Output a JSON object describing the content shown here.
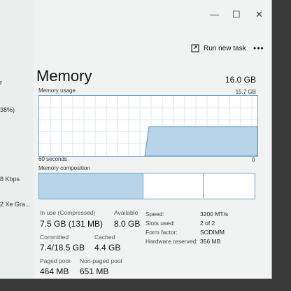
{
  "sidebar": {
    "labels": [
      "r",
      "38%)",
      "8 Kbps",
      "2 Xe Gra..."
    ]
  },
  "titlebar": {
    "minimize": "—",
    "maximize": "☐",
    "close": "✕"
  },
  "toolbar": {
    "run_new_task": "Run new task",
    "more": "•••"
  },
  "memory": {
    "title": "Memory",
    "total": "16.0 GB",
    "usage_label": "Memory usage",
    "usage_max": "15.7 GB",
    "time_left": "60 seconds",
    "time_right": "0",
    "composition_label": "Memory composition"
  },
  "stats": {
    "in_use_label": "In use (Compressed)",
    "in_use_value": "7.5 GB (131 MB)",
    "available_label": "Available",
    "available_value": "8.0 GB",
    "committed_label": "Committed",
    "committed_value": "7.4/18.5 GB",
    "cached_label": "Cached",
    "cached_value": "4.4 GB",
    "paged_label": "Paged pool",
    "paged_value": "464 MB",
    "nonpaged_label": "Non-paged pool",
    "nonpaged_value": "651 MB"
  },
  "details": {
    "speed_label": "Speed:",
    "speed_value": "3200 MT/s",
    "slots_label": "Slots used:",
    "slots_value": "2 of 2",
    "form_label": "Form factor:",
    "form_value": "SODIMM",
    "reserved_label": "Hardware reserved:",
    "reserved_value": "356 MB"
  },
  "colors": {
    "accent": "#6fa3c8",
    "fill": "#b8d4e8"
  }
}
